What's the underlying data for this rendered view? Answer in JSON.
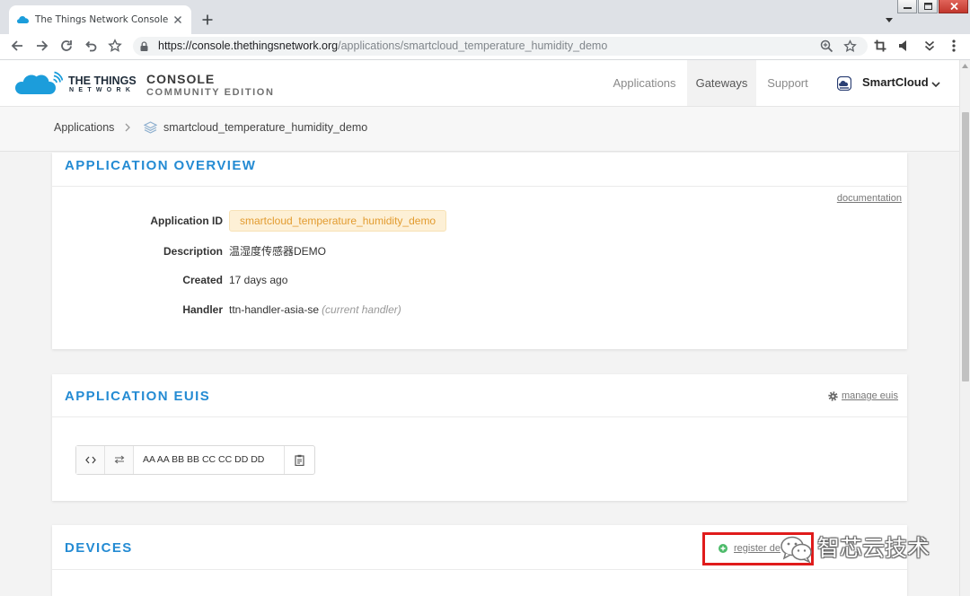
{
  "browser": {
    "tab": {
      "title": "The Things Network Console"
    },
    "address": {
      "host": "https://console.thethingsnetwork.org",
      "path": "/applications/smartcloud_temperature_humidity_demo"
    }
  },
  "header": {
    "logo": {
      "line1": "THE THINGS",
      "line2": "NETWORK"
    },
    "product": {
      "name": "CONSOLE",
      "edition": "COMMUNITY EDITION"
    },
    "nav": [
      {
        "label": "Applications",
        "highlighted": false
      },
      {
        "label": "Gateways",
        "highlighted": true
      },
      {
        "label": "Support",
        "highlighted": false
      }
    ],
    "user": {
      "name": "SmartCloud"
    }
  },
  "breadcrumb": {
    "root": "Applications",
    "current": "smartcloud_temperature_humidity_demo"
  },
  "overview": {
    "title": "APPLICATION OVERVIEW",
    "doc_link": "documentation",
    "rows": [
      {
        "label": "Application ID",
        "value": "smartcloud_temperature_humidity_demo"
      },
      {
        "label": "Description",
        "value": "温湿度传感器DEMO"
      },
      {
        "label": "Created",
        "value": "17 days ago"
      },
      {
        "label": "Handler",
        "value": "ttn-handler-asia-se",
        "note": "(current handler)"
      }
    ]
  },
  "euis": {
    "title": "APPLICATION EUIS",
    "manage_link": "manage euis",
    "items": [
      {
        "value": "AA AA BB BB CC CC DD DD"
      }
    ]
  },
  "devices": {
    "title": "DEVICES",
    "register_link": "register de"
  },
  "watermark": {
    "text": "智芯云技术"
  },
  "icons": {
    "tab": "ttn-favicon-icon",
    "toolbar": [
      "back-arrow-icon",
      "forward-arrow-icon",
      "reload-icon",
      "undo-arrow-icon",
      "bookmarks-star-icon",
      "lock-icon",
      "zoom-icon",
      "bookmark-star-icon",
      "crop-icon",
      "speaker-icon",
      "double-chevron-down-icon",
      "kebab-menu-icon"
    ],
    "page": [
      "ttn-logo-icon",
      "user-avatar-icon",
      "chevron-down-icon",
      "breadcrumb-chevron-icon",
      "layers-icon",
      "gear-icon",
      "code-icon",
      "swap-icon",
      "clipboard-icon",
      "add-circle-icon",
      "wechat-icon"
    ]
  },
  "colors": {
    "accent": "#248bd3",
    "tag_bg": "#fdf0d6",
    "tag_text": "#e29b2f",
    "register_icon": "#4dbb6a",
    "annotation": "#e01b1b",
    "logo": "#1c9ddb"
  }
}
